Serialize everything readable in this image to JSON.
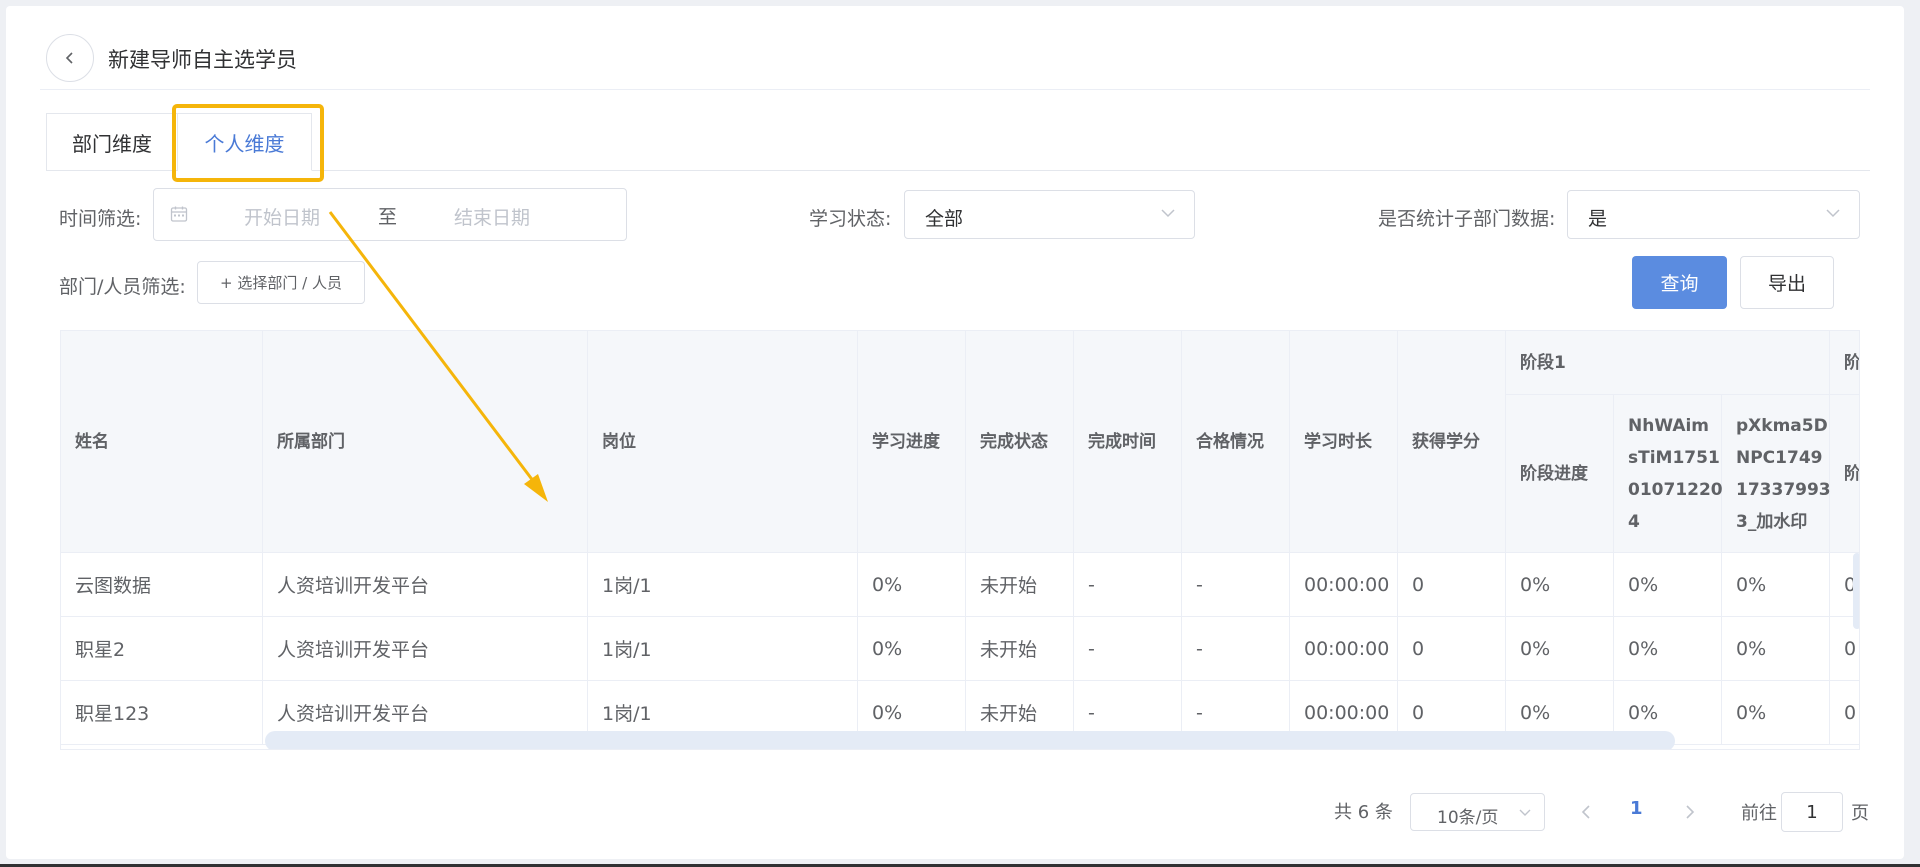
{
  "header": {
    "title": "新建导师自主选学员"
  },
  "tabs": [
    {
      "label": "部门维度",
      "active": false
    },
    {
      "label": "个人维度",
      "active": true
    }
  ],
  "filters": {
    "time_label": "时间筛选:",
    "start_placeholder": "开始日期",
    "range_separator": "至",
    "end_placeholder": "结束日期",
    "status_label": "学习状态:",
    "status_value": "全部",
    "sub_dept_label": "是否统计子部门数据:",
    "sub_dept_value": "是",
    "dept_label": "部门/人员筛选:",
    "dept_button": "+ 选择部门 / 人员",
    "query_button": "查询",
    "export_button": "导出"
  },
  "table": {
    "columns": [
      "姓名",
      "所属部门",
      "岗位",
      "学习进度",
      "完成状态",
      "完成时间",
      "合格情况",
      "学习时长",
      "获得学分"
    ],
    "group_header": "阶段1",
    "group_header_next": "阶",
    "sub_columns": [
      "阶段进度",
      "NhWAimsTiM1751010712204",
      "pXkma5DNPC17491733799 3_加水印"
    ],
    "sub_columns_display": [
      [
        "阶段进度"
      ],
      [
        "NhWAim",
        "sTiM1751",
        "01071220",
        "4"
      ],
      [
        "pXkma5D",
        "NPC1749",
        "17337993",
        "3_加水印"
      ]
    ],
    "next_sub_column": "阶",
    "rows": [
      {
        "name": "云图数据",
        "dept": "人资培训开发平台",
        "post": "1岗/1",
        "progress": "0%",
        "status": "未开始",
        "finish_time": "-",
        "qualified": "-",
        "duration": "00:00:00",
        "credit": "0",
        "stage_progress": "0%",
        "c1": "0%",
        "c2": "0%",
        "c3": "0"
      },
      {
        "name": "职星2",
        "dept": "人资培训开发平台",
        "post": "1岗/1",
        "progress": "0%",
        "status": "未开始",
        "finish_time": "-",
        "qualified": "-",
        "duration": "00:00:00",
        "credit": "0",
        "stage_progress": "0%",
        "c1": "0%",
        "c2": "0%",
        "c3": "0"
      },
      {
        "name": "职星123",
        "dept": "人资培训开发平台",
        "post": "1岗/1",
        "progress": "0%",
        "status": "未开始",
        "finish_time": "-",
        "qualified": "-",
        "duration": "00:00:00",
        "credit": "0",
        "stage_progress": "0%",
        "c1": "0%",
        "c2": "0%",
        "c3": "0"
      }
    ]
  },
  "pagination": {
    "total": "共 6 条",
    "page_size": "10条/页",
    "current_page": "1",
    "goto_label": "前往",
    "goto_value": "1",
    "goto_suffix": "页"
  },
  "colors": {
    "primary": "#5b8ce0",
    "highlight": "#f5b50a",
    "active_tab": "#4a7ad6"
  }
}
